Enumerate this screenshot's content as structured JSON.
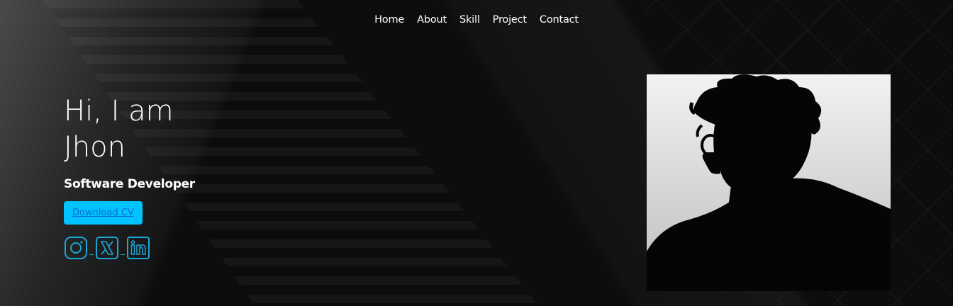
{
  "nav": {
    "items": [
      {
        "label": "Home"
      },
      {
        "label": "About"
      },
      {
        "label": "Skill"
      },
      {
        "label": "Project"
      },
      {
        "label": "Contact"
      }
    ]
  },
  "hero": {
    "greeting_line1": "Hi, I am",
    "greeting_line2": "Jhon",
    "role": "Software Developer",
    "cv_button_label": "Download CV"
  },
  "socials": [
    {
      "icon": "instagram-icon"
    },
    {
      "icon": "x-twitter-icon"
    },
    {
      "icon": "linkedin-icon"
    }
  ],
  "colors": {
    "accent": "#00c3ff",
    "icon_stroke": "#1aa7d6",
    "background": "#0d0d0d",
    "text": "#ffffff"
  }
}
